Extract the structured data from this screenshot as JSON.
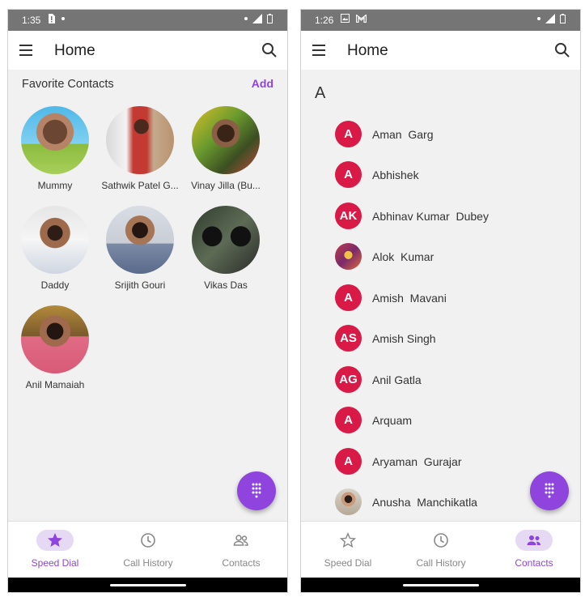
{
  "colors": {
    "accent": "#8e44dd",
    "initial_bg": "#d91a46",
    "status_bar": "#757575",
    "background": "#f1f1f1"
  },
  "left_screen": {
    "status": {
      "time": "1:35"
    },
    "appbar": {
      "title": "Home"
    },
    "favorites": {
      "header": "Favorite Contacts",
      "add_label": "Add",
      "items": [
        {
          "name": "Mummy"
        },
        {
          "name": "Sathwik Patel G..."
        },
        {
          "name": "Vinay Jilla (Bu..."
        },
        {
          "name": "Daddy"
        },
        {
          "name": "Srijith Gouri"
        },
        {
          "name": "Vikas Das"
        },
        {
          "name": "Anil Mamaiah"
        }
      ]
    },
    "nav": [
      {
        "label": "Speed Dial",
        "icon": "star-icon",
        "active": true
      },
      {
        "label": "Call History",
        "icon": "clock-icon",
        "active": false
      },
      {
        "label": "Contacts",
        "icon": "people-icon",
        "active": false
      }
    ]
  },
  "right_screen": {
    "status": {
      "time": "1:26"
    },
    "appbar": {
      "title": "Home"
    },
    "section_letter": "A",
    "contacts": [
      {
        "initials": "A",
        "name": "Aman  Garg"
      },
      {
        "initials": "A",
        "name": "Abhishek"
      },
      {
        "initials": "AK",
        "name": "Abhinav Kumar  Dubey"
      },
      {
        "initials": "",
        "name": "Alok  Kumar",
        "photo": true
      },
      {
        "initials": "A",
        "name": "Amish  Mavani"
      },
      {
        "initials": "AS",
        "name": "Amish Singh"
      },
      {
        "initials": "AG",
        "name": "Anil Gatla"
      },
      {
        "initials": "A",
        "name": "Arquam"
      },
      {
        "initials": "A",
        "name": "Aryaman  Gurajar"
      },
      {
        "initials": "",
        "name": "Anusha  Manchikatla",
        "photo": true
      }
    ],
    "nav": [
      {
        "label": "Speed Dial",
        "icon": "star-outline-icon",
        "active": false
      },
      {
        "label": "Call History",
        "icon": "clock-icon",
        "active": false
      },
      {
        "label": "Contacts",
        "icon": "people-icon",
        "active": true
      }
    ]
  }
}
